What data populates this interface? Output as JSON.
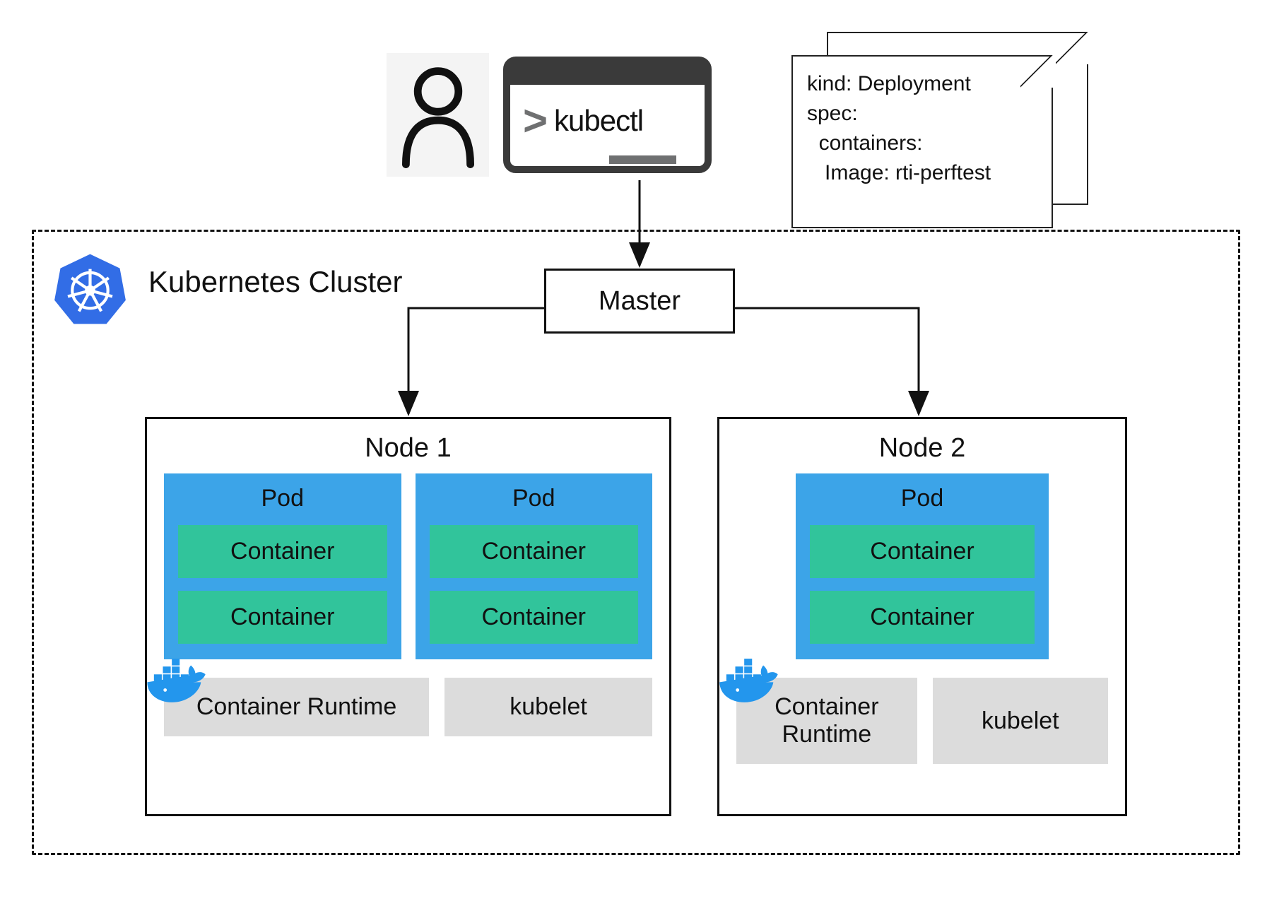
{
  "terminal": {
    "command": "kubectl"
  },
  "yaml": {
    "line1": "kind: Deployment",
    "line2": "spec:",
    "line3": "  containers:",
    "line4": "   Image: rti-perftest"
  },
  "cluster": {
    "title": "Kubernetes Cluster",
    "master": "Master"
  },
  "nodes": [
    {
      "title": "Node 1",
      "pods": [
        {
          "title": "Pod",
          "containers": [
            "Container",
            "Container"
          ]
        },
        {
          "title": "Pod",
          "containers": [
            "Container",
            "Container"
          ]
        }
      ],
      "runtime": "Container Runtime",
      "kubelet": "kubelet"
    },
    {
      "title": "Node 2",
      "pods": [
        {
          "title": "Pod",
          "containers": [
            "Container",
            "Container"
          ]
        }
      ],
      "runtime": "Container Runtime",
      "kubelet": "kubelet"
    }
  ],
  "colors": {
    "pod": "#3ca4e8",
    "container": "#31c49b",
    "grey": "#dcdcdc",
    "k8s": "#326de6",
    "docker": "#2396ed"
  }
}
